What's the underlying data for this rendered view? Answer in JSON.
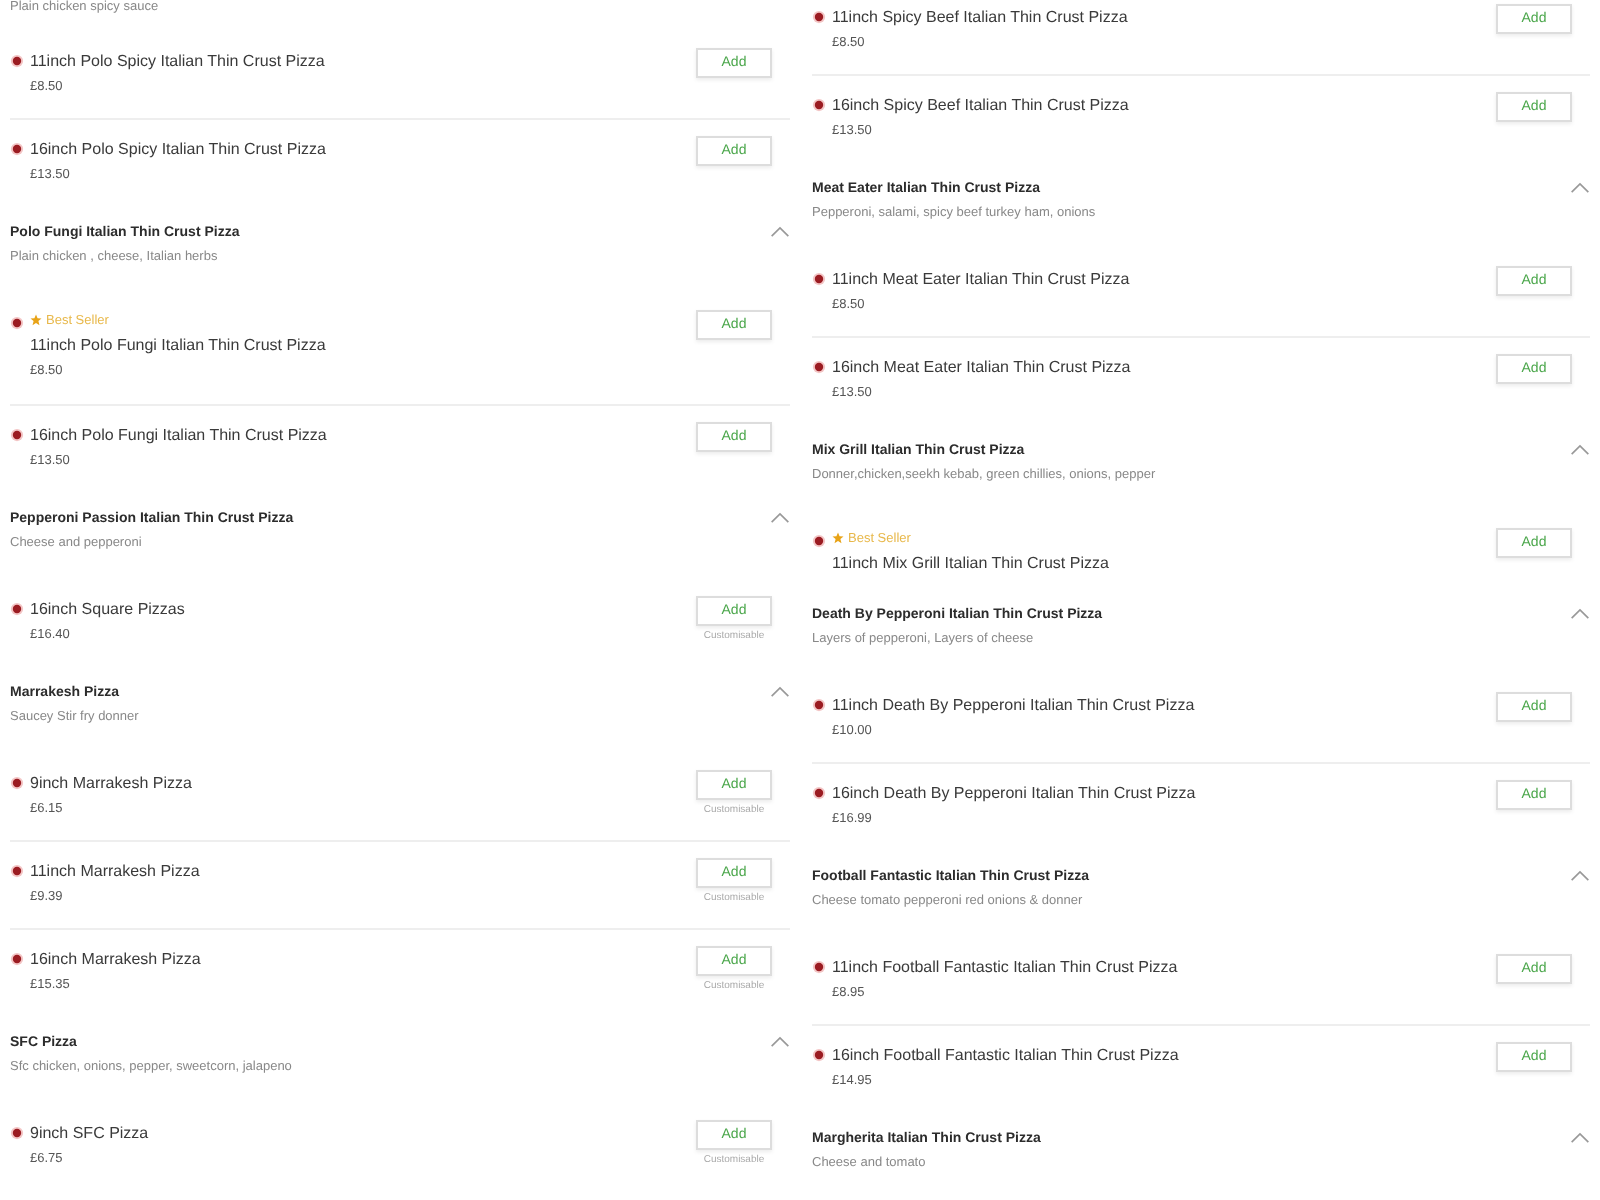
{
  "columns": [
    {
      "entries": [
        {
          "kind": "description",
          "text": "Plain chicken spicy sauce"
        },
        {
          "kind": "item",
          "name": "11inch Polo Spicy Italian Thin Crust Pizza",
          "price": "£8.50",
          "button": "Add"
        },
        {
          "kind": "item",
          "name": "16inch Polo Spicy Italian Thin Crust Pizza",
          "price": "£13.50",
          "button": "Add"
        },
        {
          "kind": "section",
          "title": "Polo Fungi Italian Thin Crust Pizza",
          "description": "Plain chicken , cheese, Italian herbs",
          "expanded": true
        },
        {
          "kind": "item",
          "badge": "Best Seller",
          "name": "11inch Polo Fungi Italian Thin Crust Pizza",
          "price": "£8.50",
          "button": "Add"
        },
        {
          "kind": "item",
          "name": "16inch Polo Fungi Italian Thin Crust Pizza",
          "price": "£13.50",
          "button": "Add"
        },
        {
          "kind": "section",
          "title": "Pepperoni Passion Italian Thin Crust Pizza",
          "description": "Cheese and pepperoni",
          "expanded": true
        },
        {
          "kind": "item",
          "name": "16inch Square Pizzas",
          "price": "£16.40",
          "button": "Add",
          "note": "Customisable"
        },
        {
          "kind": "section",
          "title": "Marrakesh Pizza",
          "description": "Saucey Stir fry donner",
          "expanded": true
        },
        {
          "kind": "item",
          "name": "9inch Marrakesh Pizza",
          "price": "£6.15",
          "button": "Add",
          "note": "Customisable"
        },
        {
          "kind": "item",
          "name": "11inch Marrakesh Pizza",
          "price": "£9.39",
          "button": "Add",
          "note": "Customisable"
        },
        {
          "kind": "item",
          "name": "16inch Marrakesh Pizza",
          "price": "£15.35",
          "button": "Add",
          "note": "Customisable"
        },
        {
          "kind": "section",
          "title": "SFC Pizza",
          "description": "Sfc chicken, onions, pepper, sweetcorn, jalapeno",
          "expanded": true
        },
        {
          "kind": "item",
          "name": "9inch SFC Pizza",
          "price": "£6.75",
          "button": "Add",
          "note": "Customisable"
        }
      ]
    },
    {
      "entries": [
        {
          "kind": "item",
          "name": "11inch Spicy Beef Italian Thin Crust Pizza",
          "price": "£8.50",
          "button": "Add"
        },
        {
          "kind": "item",
          "name": "16inch Spicy Beef Italian Thin Crust Pizza",
          "price": "£13.50",
          "button": "Add"
        },
        {
          "kind": "section",
          "title": "Meat Eater Italian Thin Crust Pizza",
          "description": "Pepperoni, salami, spicy beef turkey ham, onions",
          "expanded": true
        },
        {
          "kind": "item",
          "name": "11inch Meat Eater Italian Thin Crust Pizza",
          "price": "£8.50",
          "button": "Add"
        },
        {
          "kind": "item",
          "name": "16inch Meat Eater Italian Thin Crust Pizza",
          "price": "£13.50",
          "button": "Add"
        },
        {
          "kind": "section",
          "title": "Mix Grill Italian Thin Crust Pizza",
          "description": "Donner,chicken,seekh kebab, green chillies, onions, pepper",
          "expanded": true
        },
        {
          "kind": "item",
          "badge": "Best Seller",
          "name": "11inch Mix Grill Italian Thin Crust Pizza",
          "button": "Add"
        },
        {
          "kind": "section",
          "title": "Death By Pepperoni Italian Thin Crust Pizza",
          "description": "Layers of pepperoni, Layers of cheese",
          "expanded": true
        },
        {
          "kind": "item",
          "name": "11inch Death By Pepperoni Italian Thin Crust Pizza",
          "price": "£10.00",
          "button": "Add"
        },
        {
          "kind": "item",
          "name": "16inch Death By Pepperoni Italian Thin Crust Pizza",
          "price": "£16.99",
          "button": "Add"
        },
        {
          "kind": "section",
          "title": "Football Fantastic Italian Thin Crust Pizza",
          "description": "Cheese tomato pepperoni red onions & donner",
          "expanded": true
        },
        {
          "kind": "item",
          "name": "11inch Football Fantastic Italian Thin Crust Pizza",
          "price": "£8.95",
          "button": "Add"
        },
        {
          "kind": "item",
          "name": "16inch Football Fantastic Italian Thin Crust Pizza",
          "price": "£14.95",
          "button": "Add"
        },
        {
          "kind": "section",
          "title": "Margherita Italian Thin Crust Pizza",
          "description": "Cheese and tomato",
          "expanded": true
        }
      ]
    }
  ]
}
